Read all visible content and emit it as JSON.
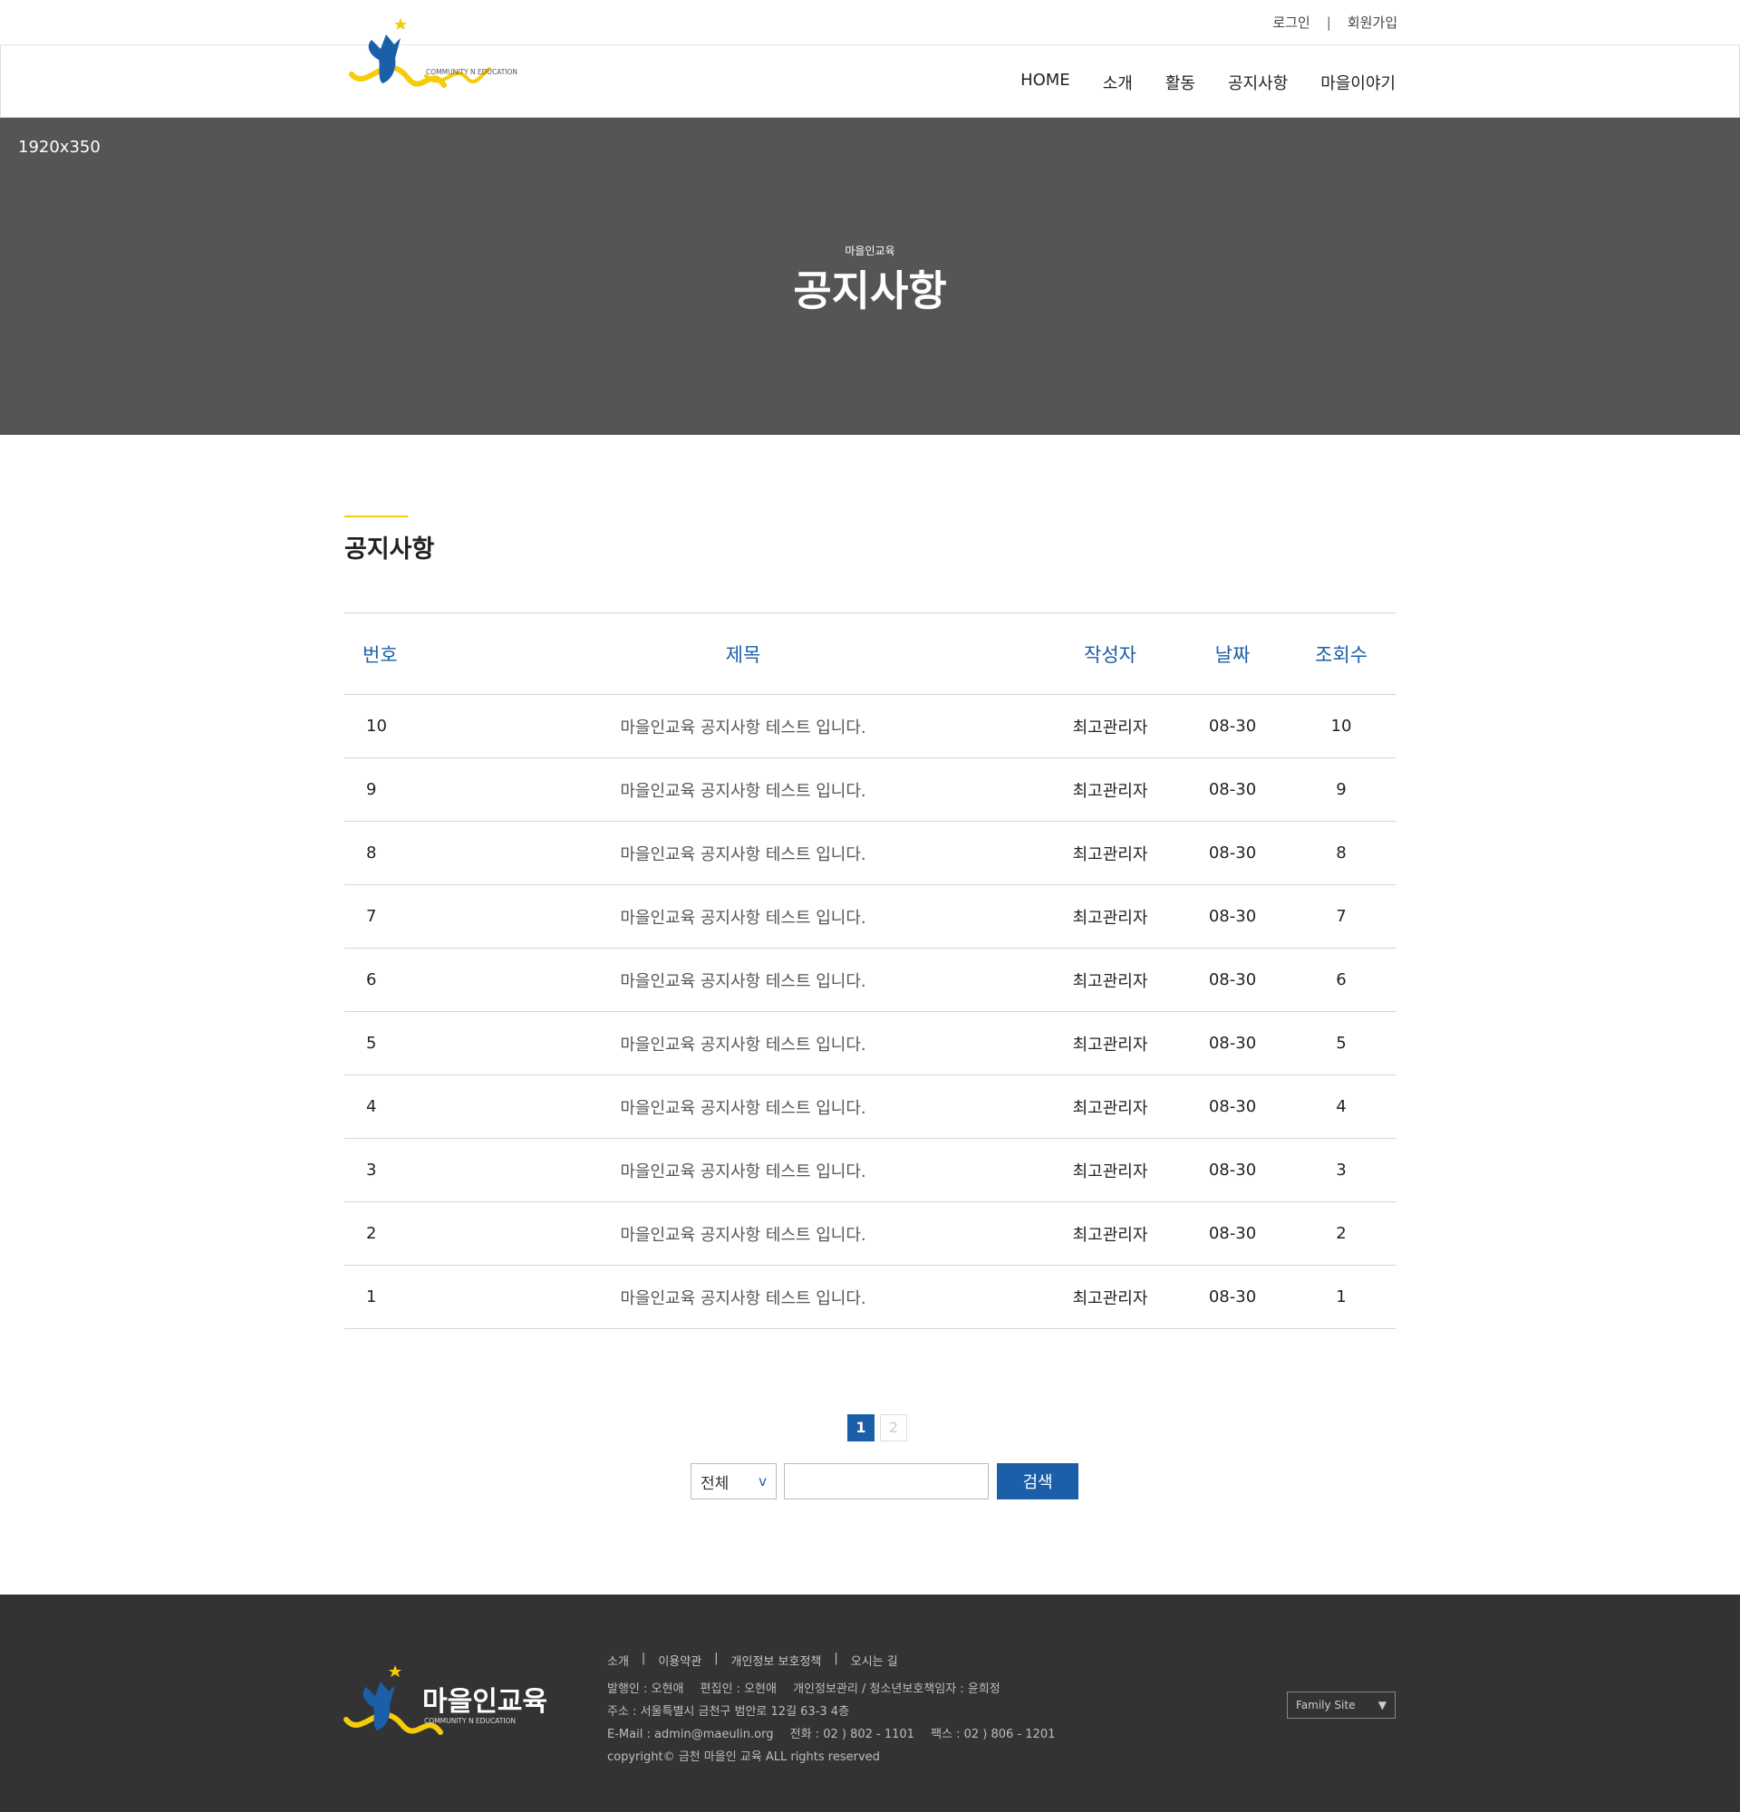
{
  "header": {
    "login": "로그인",
    "sep": "|",
    "signup": "회원가입",
    "logo_tagline": "COMMUNITY N EDUCATION",
    "nav": [
      "HOME",
      "소개",
      "활동",
      "공지사항",
      "마을이야기"
    ]
  },
  "hero": {
    "placeholder": "1920x350",
    "sub": "마을인교육",
    "title": "공지사항"
  },
  "section": {
    "title": "공지사항"
  },
  "board": {
    "headers": {
      "num": "번호",
      "subject": "제목",
      "writer": "작성자",
      "date": "날짜",
      "views": "조회수"
    },
    "rows": [
      {
        "num": "10",
        "subject": "마을인교육 공지사항 테스트 입니다.",
        "writer": "최고관리자",
        "date": "08-30",
        "views": "10"
      },
      {
        "num": "9",
        "subject": "마을인교육 공지사항 테스트 입니다.",
        "writer": "최고관리자",
        "date": "08-30",
        "views": "9"
      },
      {
        "num": "8",
        "subject": "마을인교육 공지사항 테스트 입니다.",
        "writer": "최고관리자",
        "date": "08-30",
        "views": "8"
      },
      {
        "num": "7",
        "subject": "마을인교육 공지사항 테스트 입니다.",
        "writer": "최고관리자",
        "date": "08-30",
        "views": "7"
      },
      {
        "num": "6",
        "subject": "마을인교육 공지사항 테스트 입니다.",
        "writer": "최고관리자",
        "date": "08-30",
        "views": "6"
      },
      {
        "num": "5",
        "subject": "마을인교육 공지사항 테스트 입니다.",
        "writer": "최고관리자",
        "date": "08-30",
        "views": "5"
      },
      {
        "num": "4",
        "subject": "마을인교육 공지사항 테스트 입니다.",
        "writer": "최고관리자",
        "date": "08-30",
        "views": "4"
      },
      {
        "num": "3",
        "subject": "마을인교육 공지사항 테스트 입니다.",
        "writer": "최고관리자",
        "date": "08-30",
        "views": "3"
      },
      {
        "num": "2",
        "subject": "마을인교육 공지사항 테스트 입니다.",
        "writer": "최고관리자",
        "date": "08-30",
        "views": "2"
      },
      {
        "num": "1",
        "subject": "마을인교육 공지사항 테스트 입니다.",
        "writer": "최고관리자",
        "date": "08-30",
        "views": "1"
      }
    ]
  },
  "pagination": {
    "pages": [
      "1",
      "2"
    ],
    "current": "1"
  },
  "search": {
    "select_value": "전체",
    "chevron": "v",
    "input_value": "",
    "button": "검색"
  },
  "footer": {
    "logo_text": "마을인교육",
    "logo_tagline": "COMMUNITY N EDUCATION",
    "links": [
      "소개",
      "이용약관",
      "개인정보 보호정책",
      "오시는 길"
    ],
    "info": {
      "publisher": "발행인 : 오현애",
      "editor": "편집인 : 오현애",
      "privacy": "개인정보관리 / 청소년보호책임자 : 윤희정",
      "address": "주소 : 서울특별시 금천구 범안로 12길 63-3 4층",
      "email": "E-Mail : admin@maeulin.org",
      "tel": "전화 : 02 ) 802 - 1101",
      "fax": "팩스 : 02 ) 806 - 1201",
      "copyright": "copyright© 금천 마을인 교육 ALL rights reserved"
    },
    "family_site": "Family Site",
    "family_arrow": "▼"
  },
  "colors": {
    "accent": "#1b5fa8",
    "yellow": "#f5cc0a",
    "hero_bg": "#555555",
    "footer_bg": "#333333"
  }
}
